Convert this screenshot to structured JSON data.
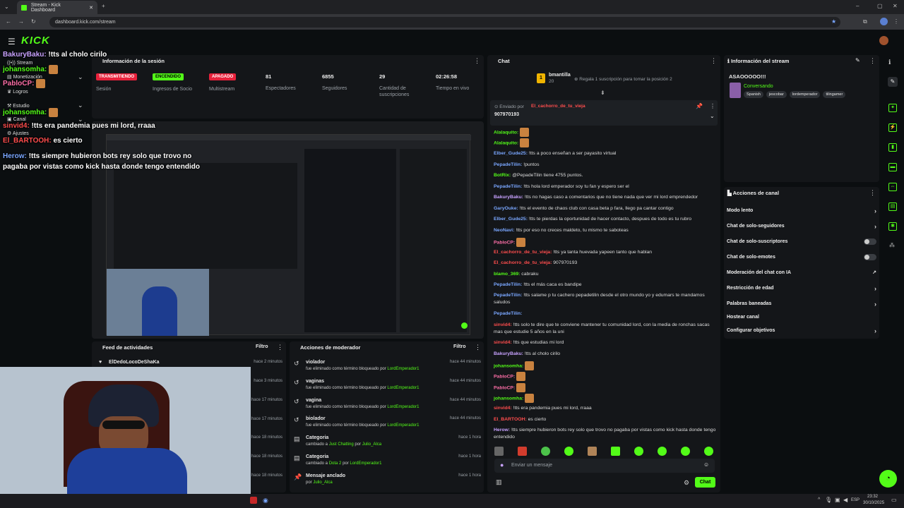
{
  "browser": {
    "tab_title": "Stream - Kick Dashboard",
    "url": "dashboard.kick.com/stream",
    "clock_time": "23:32",
    "clock_date": "30/10/2025",
    "lang": "ESP"
  },
  "sidebar": {
    "items": [
      {
        "label": "Stream",
        "icon": "broadcast-icon"
      },
      {
        "label": "Monetización",
        "icon": "money-icon"
      },
      {
        "label": "Logros",
        "icon": "trophy-icon"
      },
      {
        "label": "Estudio",
        "icon": "studio-icon"
      },
      {
        "label": "Canal",
        "icon": "channel-icon"
      },
      {
        "label": "Ajustes",
        "icon": "gear-icon"
      }
    ]
  },
  "overlay_chat": [
    {
      "user": "BakuryBaku:",
      "text": "!tts al cholo cirilo",
      "color": "#c8a2ff"
    },
    {
      "user": "johansomha:",
      "text": "",
      "color": "#53fc18"
    },
    {
      "user": "PabloCP:",
      "text": "",
      "color": "#ff6fa8"
    },
    {
      "user": "johansomha:",
      "text": "",
      "color": "#53fc18"
    },
    {
      "user": "sinvid4:",
      "text": "!tts era pandemia pues mi lord, rraaa",
      "color": "#ff4d4d"
    },
    {
      "user": "El_BARTOOH:",
      "text": "es cierto",
      "color": "#ff4d4d"
    },
    {
      "user": "Herow:",
      "text": "!tts siempre hubieron bots rey solo que trovo no pagaba por vistas como kick hasta donde tengo entendido",
      "color": "#7aa7ff"
    }
  ],
  "session": {
    "title": "Información de la sesión",
    "badges": [
      {
        "badge": "TRANSMITIENDO",
        "label": "Sesión",
        "color": "#e8213b"
      },
      {
        "badge": "ENCENDIDO",
        "label": "Ingresos de Socio",
        "color": "#53fc18"
      },
      {
        "badge": "APAGADO",
        "label": "Multistream",
        "color": "#e8213b"
      }
    ],
    "stats": [
      {
        "value": "81",
        "label": "Espectadores"
      },
      {
        "value": "6855",
        "label": "Seguidores"
      },
      {
        "value": "29",
        "label": "Cantidad de suscripciones"
      },
      {
        "value": "02:26:58",
        "label": "Tiempo en vivo"
      }
    ]
  },
  "feed": {
    "title": "Feed de actividades",
    "filter": "Filtro",
    "items": [
      {
        "user": "ElDedoLocoDeShaKa",
        "time": "hace 2 minutos"
      },
      {
        "user": "",
        "time": "hace 3 minutos"
      },
      {
        "user": "",
        "time": "hace 17 minutos"
      },
      {
        "user": "",
        "time": "hace 17 minutos"
      },
      {
        "user": "",
        "time": "hace 18 minutos"
      },
      {
        "user": "",
        "time": "hace 18 minutos"
      },
      {
        "user": "",
        "time": "hace 18 minutos"
      }
    ]
  },
  "mod_actions": {
    "title": "Acciones de moderador",
    "filter": "Filtro",
    "items": [
      {
        "title": "violador",
        "sub": "fue eliminado como término bloqueado por",
        "by": "LordEmperador1",
        "time": "hace 44 minutos",
        "icon": "undo-icon"
      },
      {
        "title": "vaginas",
        "sub": "fue eliminado como término bloqueado por",
        "by": "LordEmperador1",
        "time": "hace 44 minutos",
        "icon": "undo-icon"
      },
      {
        "title": "vagina",
        "sub": "fue eliminado como término bloqueado por",
        "by": "LordEmperador1",
        "time": "hace 44 minutos",
        "icon": "undo-icon"
      },
      {
        "title": "biolador",
        "sub": "fue eliminado como término bloqueado por",
        "by": "LordEmperador1",
        "time": "hace 44 minutos",
        "icon": "undo-icon"
      },
      {
        "title": "Categoria",
        "sub": "cambiado a",
        "cat": "Just Chatting",
        "por": "por",
        "by": "Julio_Alca",
        "time": "hace 1 hora",
        "icon": "category-icon"
      },
      {
        "title": "Categoria",
        "sub": "cambiado a",
        "cat": "Dota 2",
        "por": "por",
        "by": "LordEmperador1",
        "time": "hace 1 hora",
        "icon": "category-icon"
      },
      {
        "title": "Mensaje anclado",
        "sub": "por",
        "by": "Julio_Alca",
        "time": "hace 1 hora",
        "icon": "pin-icon"
      }
    ]
  },
  "chat": {
    "title": "Chat",
    "top_gifter": "bmantilla",
    "top_gifter_count": "20",
    "gift_text": "Regala 1 suscripción para tomar la posición 2",
    "pinned_label": "Enviado por",
    "pinned_user": "El_cachorro_de_tu_vieja",
    "pinned_text": "907970193",
    "placeholder": "Enviar un mensaje",
    "send_label": "Chat",
    "messages": [
      {
        "user": "Alalaquito:",
        "text": "",
        "color": "#53fc18",
        "emote": true
      },
      {
        "user": "Alalaquito:",
        "text": "",
        "color": "#53fc18",
        "emote": true
      },
      {
        "user": "Elber_Gude25:",
        "text": "!tts a poco enseñan a ser payasito virtual",
        "color": "#7aa7ff"
      },
      {
        "user": "PepadeTilin:",
        "text": "!puntos",
        "color": "#7aa7ff"
      },
      {
        "user": "BotRix:",
        "text": "@PepadeTilin tiene 4755 puntos.",
        "color": "#53fc18"
      },
      {
        "user": "PepadeTilin:",
        "text": "!tts hola lord emperador soy tu fan y espero ser el",
        "color": "#7aa7ff"
      },
      {
        "user": "BakuryBaku:",
        "text": "!tts no hagas caso a comentarios que no tiene nada que ver mi lord emprendedor",
        "color": "#c8a2ff"
      },
      {
        "user": "GaryOuke:",
        "text": "!tts el evento de chaos club con casa beta p fara, llego pa cantar contigo",
        "color": "#7aa7ff"
      },
      {
        "user": "Elber_Gude25:",
        "text": "!tts te pierdas la oportunidad de hacer contacto, despues de todo es tu rubro",
        "color": "#7aa7ff"
      },
      {
        "user": "NeoNavi:",
        "text": "!tts por eso no creces maldeto, tu mismo te saboteas",
        "color": "#7aa7ff"
      },
      {
        "user": "PabloCP:",
        "text": "",
        "color": "#ff6fa8",
        "emote": true
      },
      {
        "user": "El_cachorro_de_tu_vieja:",
        "text": "!tts ya tanta huevada yapeen tanto que hablan",
        "color": "#ff4d4d"
      },
      {
        "user": "El_cachorro_de_tu_vieja:",
        "text": "907970193",
        "color": "#ff4d4d"
      },
      {
        "user": "blamo_369:",
        "text": "cabraku",
        "color": "#53fc18"
      },
      {
        "user": "PepadeTilin:",
        "text": "!tts el más caca es bandipe",
        "color": "#7aa7ff"
      },
      {
        "user": "PepadeTilin:",
        "text": "!tts salame p tu cachero pepadetilin desde el otro mundo yo y edumars te mandamos saludos",
        "color": "#7aa7ff"
      },
      {
        "user": "PepadeTilin:",
        "text": "",
        "color": "#7aa7ff"
      },
      {
        "user": "sinvid4:",
        "text": "!tts solo te dire que te conviene mantener tu comunidad lord, con la media de ronchas sacas mas que estudie 5 años en la uni",
        "color": "#ff4d4d"
      },
      {
        "user": "sinvid4:",
        "text": "!tts que estudias mi lord",
        "color": "#ff4d4d"
      },
      {
        "user": "BakuryBaku:",
        "text": "!tts al cholo cirilo",
        "color": "#c8a2ff"
      },
      {
        "user": "johansomha:",
        "text": "",
        "color": "#53fc18",
        "emote": true
      },
      {
        "user": "PabloCP:",
        "text": "",
        "color": "#ff6fa8",
        "emote": true
      },
      {
        "user": "PabloCP:",
        "text": "",
        "color": "#ff6fa8",
        "emote": true
      },
      {
        "user": "johansomha:",
        "text": "",
        "color": "#53fc18",
        "emote": true
      },
      {
        "user": "sinvid4:",
        "text": "!tts era pandemia pues mi lord, rraaa",
        "color": "#ff4d4d"
      },
      {
        "user": "El_BARTOOH:",
        "text": "es cierto",
        "color": "#ff4d4d"
      },
      {
        "user": "Herow:",
        "text": "!tts siempre hubieron bots rey solo que trovo no pagaba por vistas como kick hasta donde tengo entendido",
        "color": "#c8a2ff"
      }
    ]
  },
  "stream_info": {
    "title": "Información del stream",
    "stream_title": "ASAOOOOO!!!",
    "category": "Conversando",
    "tags": [
      "Spanish",
      "jescobar",
      "lordemperador",
      "tilingamer"
    ]
  },
  "channel_actions": {
    "title": "Acciones de canal",
    "items": [
      {
        "label": "Modo lento",
        "control": "chevron"
      },
      {
        "label": "Chat de solo-seguidores",
        "control": "chevron"
      },
      {
        "label": "Chat de solo-suscriptores",
        "control": "toggle"
      },
      {
        "label": "Chat de solo-emotes",
        "control": "toggle"
      },
      {
        "label": "Moderación del chat con IA",
        "control": "external"
      },
      {
        "label": "Restricción de edad",
        "control": "chevron"
      },
      {
        "label": "Palabras baneadas",
        "control": "chevron"
      },
      {
        "label": "Hostear canal",
        "control": "none"
      },
      {
        "label": "Configurar objetivos",
        "control": "chevron"
      }
    ]
  },
  "colors": {
    "brand": "#53fc18",
    "live": "#e8213b",
    "panel": "#141619",
    "bg": "#0b0e10"
  }
}
